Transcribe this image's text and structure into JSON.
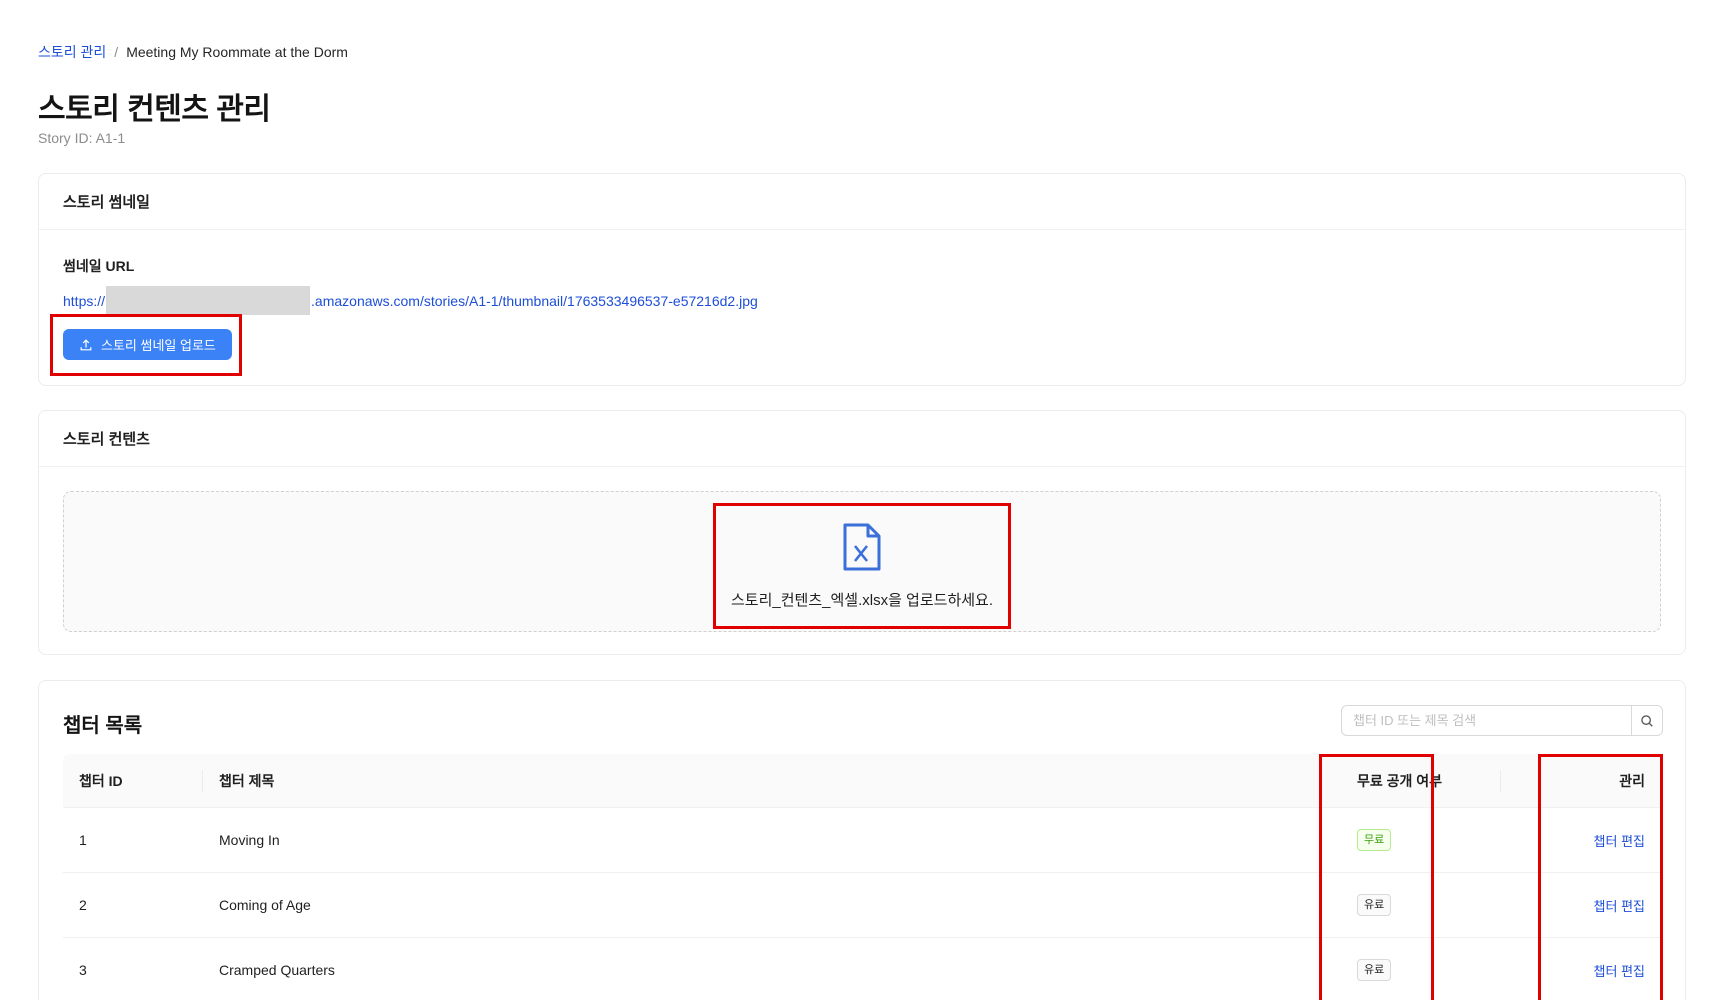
{
  "breadcrumb": {
    "parent": "스토리 관리",
    "separator": "/",
    "current": "Meeting My Roommate at the Dorm"
  },
  "page": {
    "title": "스토리 컨텐츠 관리",
    "story_id": "Story ID: A1-1"
  },
  "thumbnail_section": {
    "title": "스토리 썸네일",
    "field_label": "썸네일 URL",
    "url_prefix": "https://",
    "url_suffix": ".amazonaws.com/stories/A1-1/thumbnail/1763533496537-e57216d2.jpg",
    "upload_button": "스토리 썸네일 업로드"
  },
  "content_section": {
    "title": "스토리 컨텐츠",
    "dropzone_text": "스토리_컨텐츠_엑셀.xlsx을 업로드하세요.",
    "icon": "excel-file-icon"
  },
  "chapter_section": {
    "title": "챕터 목록",
    "search_placeholder": "챕터 ID 또는 제목 검색",
    "columns": {
      "id": "챕터 ID",
      "title": "챕터 제목",
      "free": "무료 공개 여부",
      "manage": "관리"
    },
    "rows": [
      {
        "id": "1",
        "title": "Moving In",
        "access": "무료",
        "is_free": true,
        "action": "챕터 편집"
      },
      {
        "id": "2",
        "title": "Coming of Age",
        "access": "유료",
        "is_free": false,
        "action": "챕터 편집"
      },
      {
        "id": "3",
        "title": "Cramped Quarters",
        "access": "유료",
        "is_free": false,
        "action": "챕터 편집"
      }
    ]
  },
  "colors": {
    "primary": "#3b82f6",
    "link": "#1d4ed8",
    "free_tag": "#389e0d",
    "annotation": "#e00000"
  }
}
